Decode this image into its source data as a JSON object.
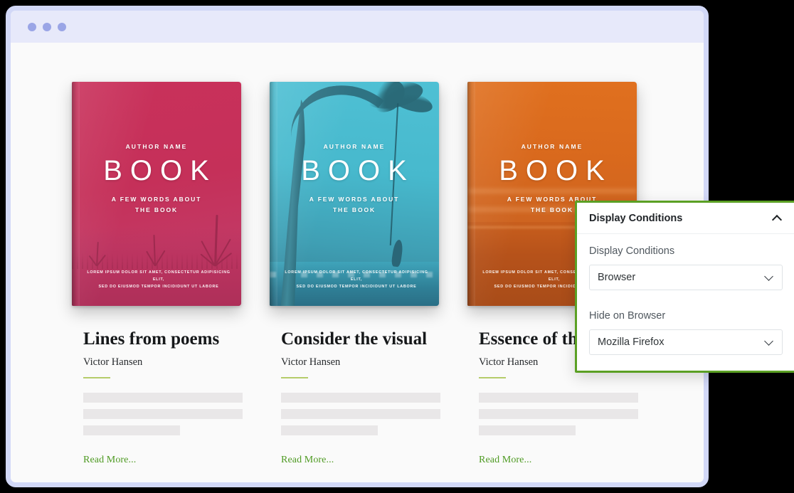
{
  "window": {
    "dots": [
      "window-dot-1",
      "window-dot-2",
      "window-dot-3"
    ]
  },
  "cover_template": {
    "author": "AUTHOR NAME",
    "title": "BOOK",
    "subtitle_line1": "A FEW WORDS ABOUT",
    "subtitle_line2": "THE BOOK",
    "footer_line1": "LOREM IPSUM DOLOR SIT AMET, CONSECTETUR ADIPISICING ELIT,",
    "footer_line2": "SED DO EIUSMOD TEMPOR INCIDIDUNT UT LABORE"
  },
  "cards": [
    {
      "title": "Lines from poems",
      "author": "Victor Hansen",
      "read_more": "Read More...",
      "cover_color": "#c53059",
      "cover_scene": "dead-trees-field"
    },
    {
      "title": "Consider the visual",
      "author": "Victor Hansen",
      "read_more": "Read More...",
      "cover_color": "#47b9cd",
      "cover_scene": "palm-tree-swing"
    },
    {
      "title": "Essence of the",
      "author": "Victor Hansen",
      "read_more": "Read More...",
      "cover_color": "#d9691d",
      "cover_scene": "orange-sunset-horizon"
    }
  ],
  "panel": {
    "header_title": "Display Conditions",
    "collapse_icon": "chevron-up-icon",
    "border_color": "#5ba024",
    "fields": [
      {
        "label": "Display Conditions",
        "value": "Browser",
        "icon": "chevron-down-icon"
      },
      {
        "label": "Hide on Browser",
        "value": "Mozilla Firefox",
        "icon": "chevron-down-icon"
      }
    ]
  },
  "theme": {
    "accent_green": "#4e9a22",
    "rule_green": "#b5cc6a",
    "titlebar": "#e7e9fa",
    "window_border": "#d2d8f7",
    "page_bg": "#fafafa"
  }
}
